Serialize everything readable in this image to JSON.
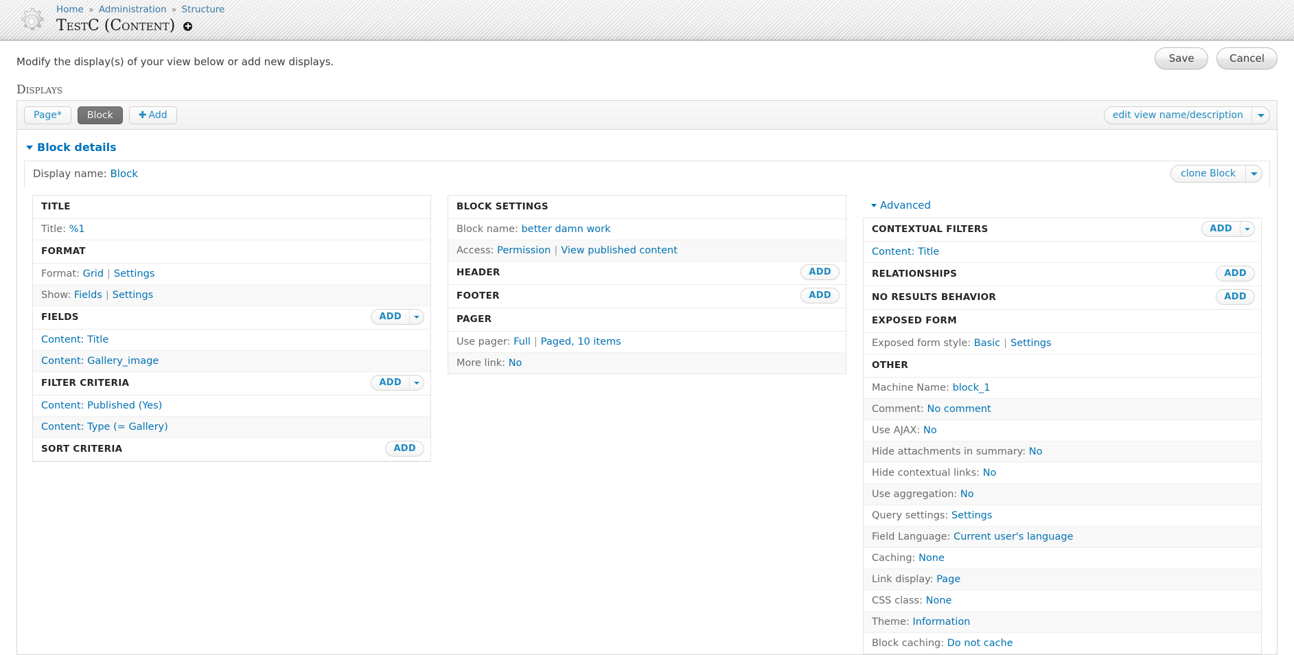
{
  "header": {
    "logo_icon": "gear-icon",
    "breadcrumb": [
      {
        "label": "Home"
      },
      {
        "label": "Administration"
      },
      {
        "label": "Structure"
      }
    ],
    "breadcrumb_separator": "»",
    "title": "TestC (Content)",
    "title_badge_icon": "plus-circle-icon"
  },
  "intro": {
    "text": "Modify the display(s) of your view below or add new displays.",
    "save_label": "Save",
    "cancel_label": "Cancel"
  },
  "displays": {
    "section_label": "Displays",
    "tabs": [
      {
        "label": "Page*",
        "active": false
      },
      {
        "label": "Block",
        "active": true
      }
    ],
    "add_tab_label": "Add",
    "edit_view_label": "edit view name/description"
  },
  "block_details": {
    "toggle_label": "Block details",
    "display_name_label": "Display name:",
    "display_name_value": "Block",
    "clone_label": "clone Block"
  },
  "left_column": {
    "buckets": [
      {
        "name": "Title",
        "heading": "TITLE",
        "add": null,
        "rows": [
          {
            "label": "Title:",
            "links": [
              {
                "text": "%1"
              }
            ]
          }
        ]
      },
      {
        "name": "Format",
        "heading": "FORMAT",
        "add": null,
        "rows": [
          {
            "label": "Format:",
            "links": [
              {
                "text": "Grid"
              },
              {
                "text": "Settings"
              }
            ]
          },
          {
            "label": "Show:",
            "links": [
              {
                "text": "Fields"
              },
              {
                "text": "Settings"
              }
            ]
          }
        ]
      },
      {
        "name": "Fields",
        "heading": "FIELDS",
        "add": {
          "label": "Add",
          "has_dropdown": true
        },
        "rows": [
          {
            "label": "",
            "links": [
              {
                "text": "Content: Title"
              }
            ]
          },
          {
            "label": "",
            "links": [
              {
                "text": "Content: Gallery_image"
              }
            ]
          }
        ]
      },
      {
        "name": "Filter criteria",
        "heading": "FILTER CRITERIA",
        "add": {
          "label": "Add",
          "has_dropdown": true
        },
        "rows": [
          {
            "label": "",
            "links": [
              {
                "text": "Content: Published (Yes)"
              }
            ]
          },
          {
            "label": "",
            "links": [
              {
                "text": "Content: Type (= Gallery)"
              }
            ]
          }
        ]
      },
      {
        "name": "Sort criteria",
        "heading": "SORT CRITERIA",
        "add": {
          "label": "Add",
          "has_dropdown": false
        },
        "rows": []
      }
    ]
  },
  "middle_column": {
    "buckets": [
      {
        "name": "Block settings",
        "heading": "BLOCK SETTINGS",
        "add": null,
        "rows": [
          {
            "label": "Block name:",
            "links": [
              {
                "text": "better damn work"
              }
            ]
          },
          {
            "label": "Access:",
            "links": [
              {
                "text": "Permission"
              },
              {
                "text": "View published content"
              }
            ]
          }
        ]
      },
      {
        "name": "Header",
        "heading": "HEADER",
        "add": {
          "label": "Add",
          "has_dropdown": false
        },
        "rows": []
      },
      {
        "name": "Footer",
        "heading": "FOOTER",
        "add": {
          "label": "Add",
          "has_dropdown": false
        },
        "rows": []
      },
      {
        "name": "Pager",
        "heading": "PAGER",
        "add": null,
        "rows": [
          {
            "label": "Use pager:",
            "links": [
              {
                "text": "Full"
              },
              {
                "text": "Paged, 10 items"
              }
            ]
          },
          {
            "label": "More link:",
            "links": [
              {
                "text": "No"
              }
            ]
          }
        ]
      }
    ]
  },
  "right_column": {
    "advanced_label": "Advanced",
    "buckets": [
      {
        "name": "Contextual filters",
        "heading": "CONTEXTUAL FILTERS",
        "add": {
          "label": "Add",
          "has_dropdown": true
        },
        "rows": [
          {
            "label": "",
            "links": [
              {
                "text": "Content: Title"
              }
            ]
          }
        ]
      },
      {
        "name": "Relationships",
        "heading": "RELATIONSHIPS",
        "add": {
          "label": "Add",
          "has_dropdown": false
        },
        "rows": []
      },
      {
        "name": "No results behavior",
        "heading": "NO RESULTS BEHAVIOR",
        "add": {
          "label": "Add",
          "has_dropdown": false
        },
        "rows": []
      },
      {
        "name": "Exposed form",
        "heading": "EXPOSED FORM",
        "add": null,
        "rows": [
          {
            "label": "Exposed form style:",
            "links": [
              {
                "text": "Basic"
              },
              {
                "text": "Settings"
              }
            ]
          }
        ]
      },
      {
        "name": "Other",
        "heading": "OTHER",
        "add": null,
        "rows": [
          {
            "label": "Machine Name:",
            "links": [
              {
                "text": "block_1"
              }
            ]
          },
          {
            "label": "Comment:",
            "links": [
              {
                "text": "No comment"
              }
            ]
          },
          {
            "label": "Use AJAX:",
            "links": [
              {
                "text": "No"
              }
            ]
          },
          {
            "label": "Hide attachments in summary:",
            "links": [
              {
                "text": "No"
              }
            ]
          },
          {
            "label": "Hide contextual links:",
            "links": [
              {
                "text": "No"
              }
            ]
          },
          {
            "label": "Use aggregation:",
            "links": [
              {
                "text": "No"
              }
            ]
          },
          {
            "label": "Query settings:",
            "links": [
              {
                "text": "Settings"
              }
            ]
          },
          {
            "label": "Field Language:",
            "links": [
              {
                "text": "Current user's language"
              }
            ]
          },
          {
            "label": "Caching:",
            "links": [
              {
                "text": "None"
              }
            ]
          },
          {
            "label": "Link display:",
            "links": [
              {
                "text": "Page"
              }
            ]
          },
          {
            "label": "CSS class:",
            "links": [
              {
                "text": "None"
              }
            ]
          },
          {
            "label": "Theme:",
            "links": [
              {
                "text": "Information"
              }
            ]
          },
          {
            "label": "Block caching:",
            "links": [
              {
                "text": "Do not cache"
              }
            ]
          }
        ]
      }
    ]
  },
  "colors": {
    "link": "#0071b3",
    "active_tab_bg": "#6d6d6d",
    "heading": "#252525"
  }
}
